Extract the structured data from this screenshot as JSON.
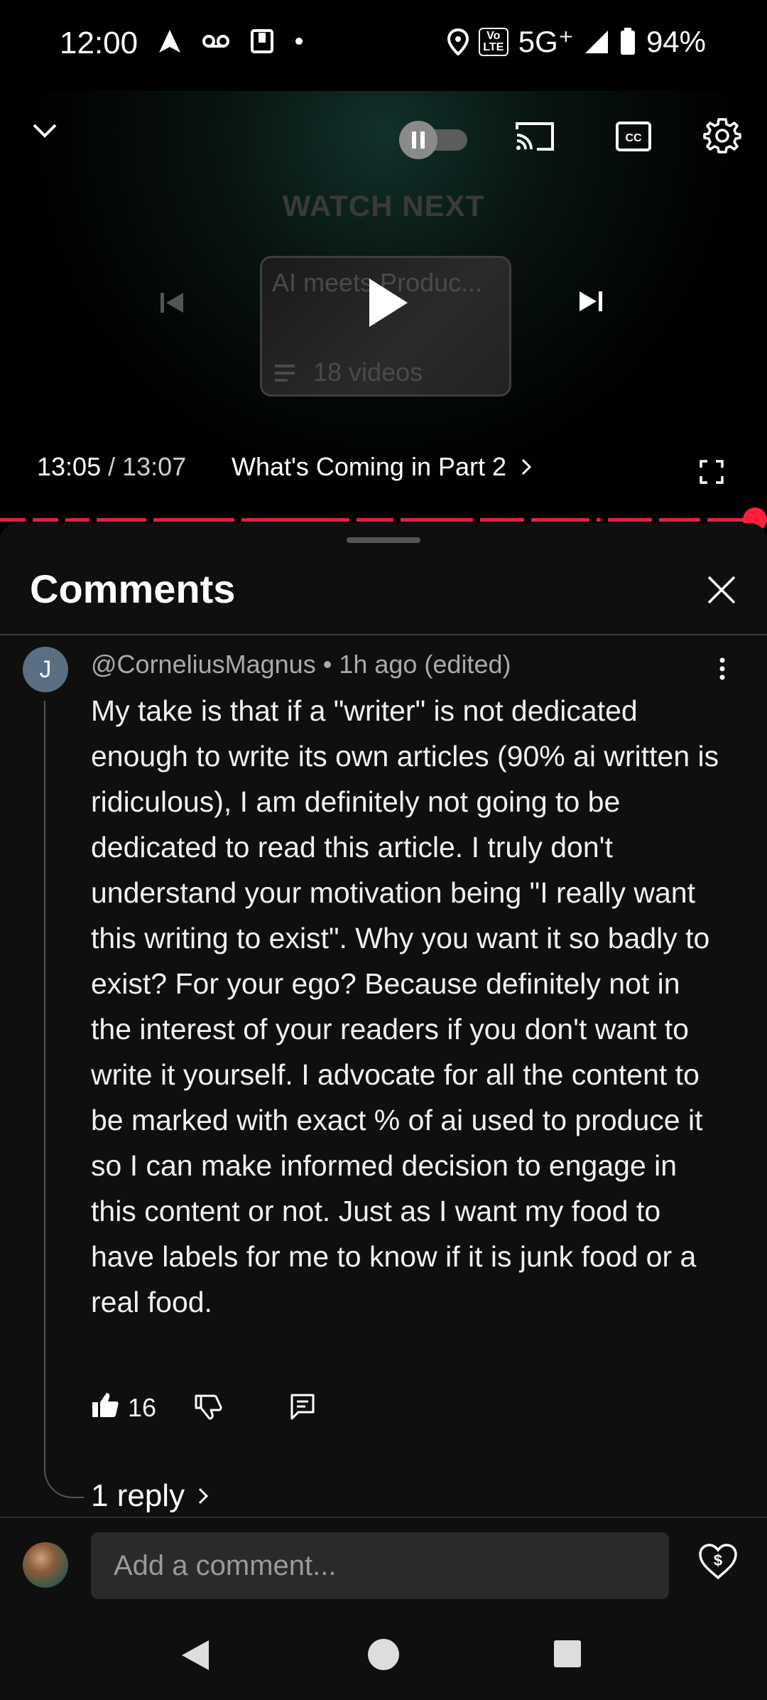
{
  "status_bar": {
    "time": "12:00",
    "network": "5G⁺",
    "volte": "Vo LTE",
    "battery": "94%"
  },
  "player": {
    "watch_next_label": "WATCH NEXT",
    "playlist_title": "AI meets Produc...",
    "playlist_count": "18 videos",
    "current_time": "13:05",
    "separator": " / ",
    "duration": "13:07",
    "chapter_title": "What's Coming in Part 2",
    "progress": 0.997,
    "autoplay": "paused",
    "accent_color": "#ff1e3c"
  },
  "comments": {
    "title": "Comments",
    "items": [
      {
        "avatar_letter": "J",
        "author": "@CorneliusMagnus",
        "meta": " • 1h ago (edited)",
        "text": "My take is that if a \"writer\" is not dedicated enough to write its own articles (90% ai written is ridiculous), I am definitely not going to be dedicated to read this article. I truly don't understand your motivation being \"I really want this writing to exist\". Why you want it so badly to exist? For your ego? Because definitely not in the interest of your readers if you don't want to write it yourself. I advocate for all the content to be marked with exact % of ai used to produce it so I can make informed decision to engage in this content or not. Just as I want my food to have labels for me to know if it is junk food or a real food.",
        "likes": "16",
        "replies_label": "1 reply"
      }
    ],
    "composer_placeholder": "Add a comment..."
  },
  "icons": {
    "collapse": "chevron-down-icon",
    "cast": "cast-icon",
    "captions": "cc-icon",
    "settings": "gear-icon",
    "previous": "skip-previous-icon",
    "play": "play-icon",
    "next": "skip-next-icon",
    "fullscreen": "fullscreen-icon",
    "close": "close-icon",
    "more": "kebab-icon",
    "like": "thumbs-up-icon",
    "dislike": "thumbs-down-icon",
    "reply": "reply-icon",
    "super_thanks": "super-thanks-icon"
  }
}
